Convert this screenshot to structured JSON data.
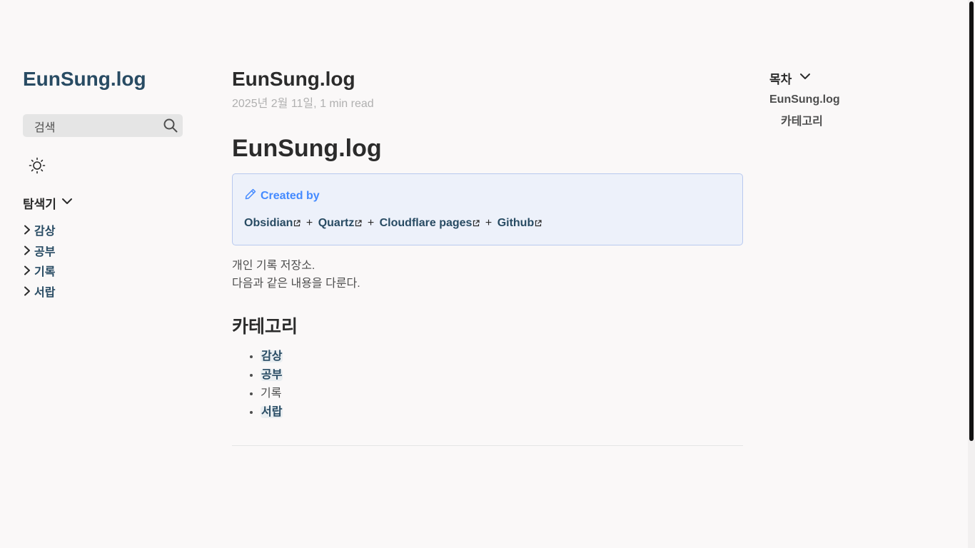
{
  "sidebar": {
    "site_title": "EunSung.log",
    "search": {
      "label": "검색",
      "icon": "search-icon"
    },
    "darkmode_icon": "sun-icon",
    "explorer": {
      "title": "탐색기",
      "items": [
        {
          "label": "감상"
        },
        {
          "label": "공부"
        },
        {
          "label": "기록"
        },
        {
          "label": "서랍"
        }
      ]
    }
  },
  "article": {
    "title": "EunSung.log",
    "meta": {
      "date": "2025년 2월 11일,",
      "read_time": "1 min read"
    },
    "h1": "EunSung.log",
    "callout": {
      "icon": "pencil-icon",
      "title": "Created by",
      "links": [
        "Obsidian",
        "Quartz",
        "Cloudflare pages",
        "Github"
      ],
      "separator": "+"
    },
    "paragraph": [
      "개인 기록 저장소.",
      "다음과 같은 내용을 다룬다."
    ],
    "h2": "카테고리",
    "categories": [
      {
        "label": "감상",
        "link": true
      },
      {
        "label": "공부",
        "link": true
      },
      {
        "label": "기록",
        "link": false
      },
      {
        "label": "서랍",
        "link": true
      }
    ]
  },
  "toc": {
    "title": "목차",
    "items": [
      "EunSung.log",
      "카테고리"
    ]
  },
  "colors": {
    "accent": "#284b63",
    "callout_accent": "#448aff",
    "callout_bg": "#edf1fa",
    "background": "#faf8f8"
  }
}
